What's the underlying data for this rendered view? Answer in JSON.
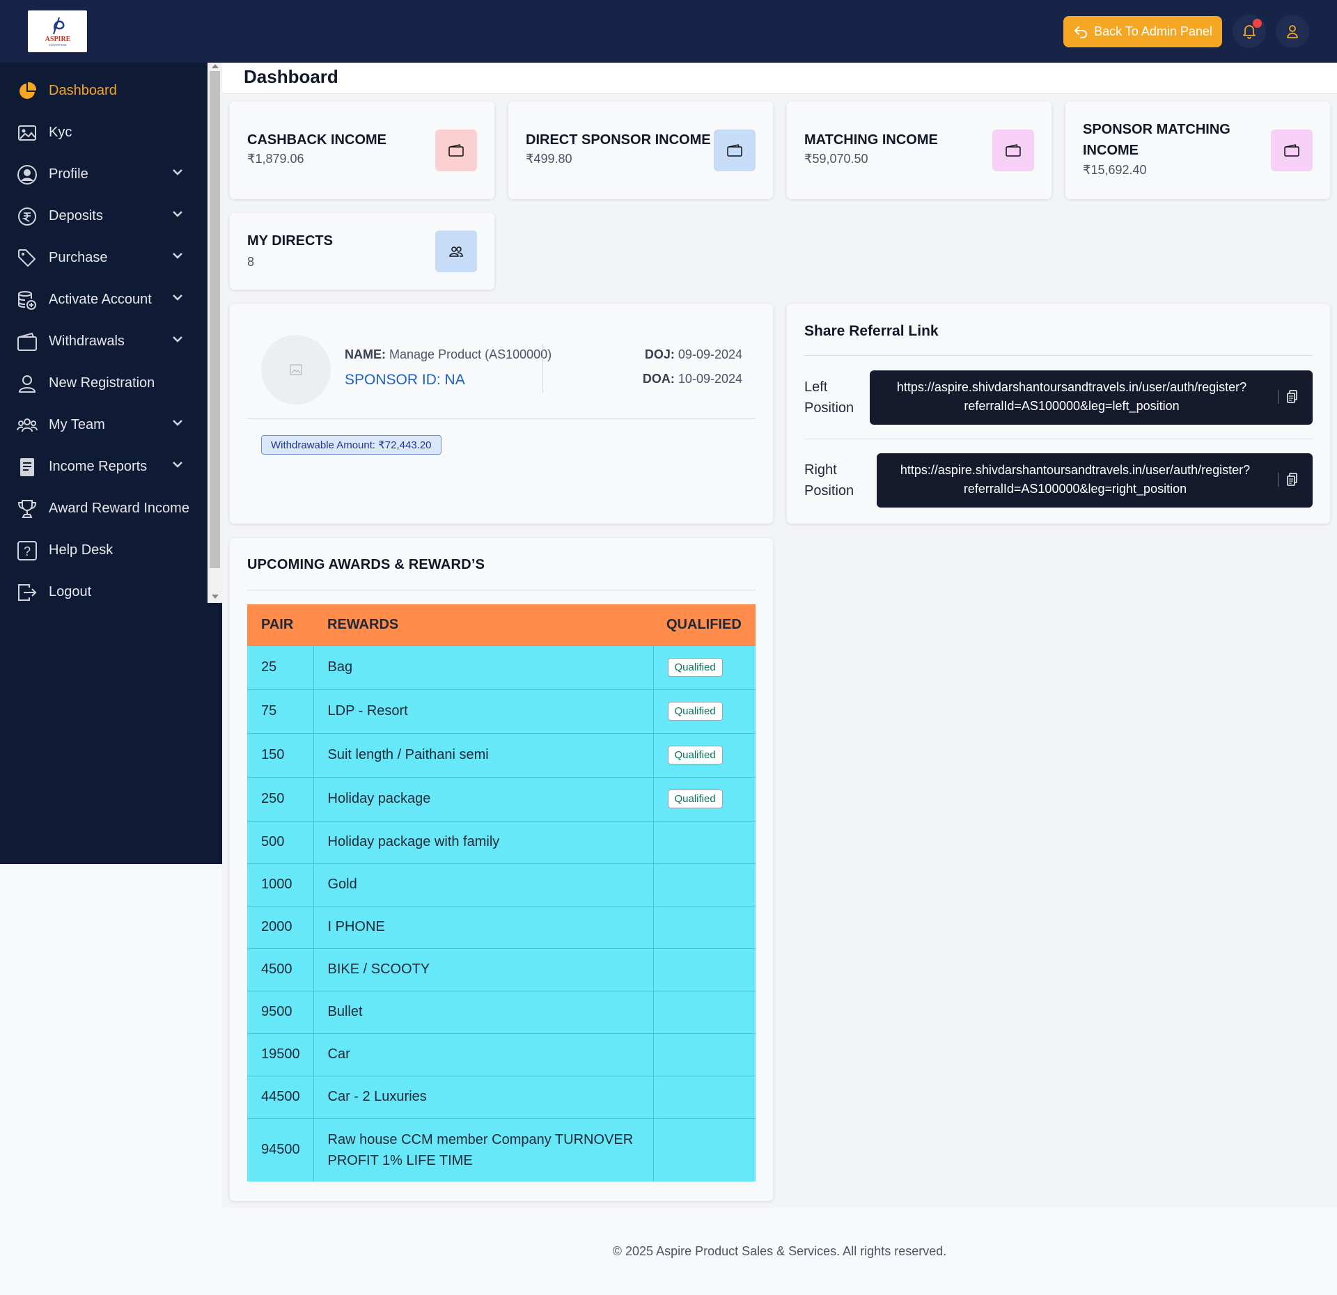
{
  "brand": {
    "logo_text": "ASPIRE",
    "logo_tagline": "ENTERPRISE"
  },
  "header": {
    "back_button_label": "Back To Admin Panel"
  },
  "sidebar": {
    "items": [
      {
        "label": "Dashboard",
        "icon": "pie-chart-icon",
        "active": true,
        "has_submenu": false
      },
      {
        "label": "Kyc",
        "icon": "image-icon",
        "active": false,
        "has_submenu": false
      },
      {
        "label": "Profile",
        "icon": "user-circle-icon",
        "active": false,
        "has_submenu": true
      },
      {
        "label": "Deposits",
        "icon": "rupee-coin-icon",
        "active": false,
        "has_submenu": true
      },
      {
        "label": "Purchase",
        "icon": "tag-icon",
        "active": false,
        "has_submenu": true
      },
      {
        "label": "Activate Account",
        "icon": "database-plus-icon",
        "active": false,
        "has_submenu": true
      },
      {
        "label": "Withdrawals",
        "icon": "wallet-icon",
        "active": false,
        "has_submenu": true
      },
      {
        "label": "New Registration",
        "icon": "user-icon",
        "active": false,
        "has_submenu": false
      },
      {
        "label": "My Team",
        "icon": "team-icon",
        "active": false,
        "has_submenu": true
      },
      {
        "label": "Income Reports",
        "icon": "document-icon",
        "active": false,
        "has_submenu": true
      },
      {
        "label": "Award Reward Income",
        "icon": "trophy-icon",
        "active": false,
        "has_submenu": false
      },
      {
        "label": "Help Desk",
        "icon": "question-icon",
        "active": false,
        "has_submenu": false
      },
      {
        "label": "Logout",
        "icon": "logout-icon",
        "active": false,
        "has_submenu": false
      }
    ]
  },
  "page": {
    "title": "Dashboard"
  },
  "stats": {
    "cashback": {
      "title": "CASHBACK INCOME",
      "value": "₹1,879.06",
      "color": "#fbd0d0"
    },
    "direct_sponsor": {
      "title": "DIRECT SPONSOR INCOME",
      "value": "₹499.80",
      "color": "#c7dcf7"
    },
    "matching": {
      "title": "MATCHING INCOME",
      "value": "₹59,070.50",
      "color": "#f7d0f7"
    },
    "sponsor_matching": {
      "title_line1": "SPONSOR MATCHING",
      "title_line2": "INCOME",
      "value": "₹15,692.40",
      "color": "#f7d0f7"
    },
    "my_directs": {
      "title": "MY DIRECTS",
      "value": "8",
      "color": "#c7dcf7"
    }
  },
  "profile": {
    "name_label": "NAME:",
    "name_value": "Manage Product (AS100000)",
    "sponsor_label": "SPONSOR ID:",
    "sponsor_value": "NA",
    "doj_label": "DOJ:",
    "doj_value": "09-09-2024",
    "doa_label": "DOA:",
    "doa_value": "10-09-2024",
    "withdrawable": "Withdrawable Amount: ₹72,443.20"
  },
  "referral": {
    "title": "Share Referral Link",
    "left_label_1": "Left",
    "left_label_2": "Position",
    "left_url_1": "https://aspire.shivdarshantoursandtravels.in/user/auth/register?",
    "left_url_2": "referralId=AS100000&leg=left_position",
    "right_label_1": "Right",
    "right_label_2": "Position",
    "right_url_1": "https://aspire.shivdarshantoursandtravels.in/user/auth/register?",
    "right_url_2": "referralId=AS100000&leg=right_position"
  },
  "awards": {
    "title": "UPCOMING AWARDS & REWARD’S",
    "columns": [
      "PAIR",
      "REWARDS",
      "QUALIFIED"
    ],
    "rows": [
      {
        "pair": "25",
        "reward": "Bag",
        "qualified": "Qualified"
      },
      {
        "pair": "75",
        "reward": "LDP - Resort",
        "qualified": "Qualified"
      },
      {
        "pair": "150",
        "reward": "Suit length / Paithani semi",
        "qualified": "Qualified"
      },
      {
        "pair": "250",
        "reward": "Holiday package",
        "qualified": "Qualified"
      },
      {
        "pair": "500",
        "reward": "Holiday package with family",
        "qualified": ""
      },
      {
        "pair": "1000",
        "reward": "Gold",
        "qualified": ""
      },
      {
        "pair": "2000",
        "reward": "I PHONE",
        "qualified": ""
      },
      {
        "pair": "4500",
        "reward": "BIKE / SCOOTY",
        "qualified": ""
      },
      {
        "pair": "9500",
        "reward": "Bullet",
        "qualified": ""
      },
      {
        "pair": "19500",
        "reward": "Car",
        "qualified": ""
      },
      {
        "pair": "44500",
        "reward": "Car - 2 Luxuries",
        "qualified": ""
      },
      {
        "pair": "94500",
        "reward": "Raw house CCM member Company TURNOVER PROFIT 1% LIFE TIME",
        "qualified": ""
      }
    ]
  },
  "footer": {
    "text": "© 2025 Aspire Product Sales & Services. All rights reserved."
  },
  "colors": {
    "accent": "#f5a623",
    "topbar": "#172447",
    "sidebar": "#0f1b35",
    "table_header": "#ff8c4a",
    "table_row": "#67e8f9"
  }
}
